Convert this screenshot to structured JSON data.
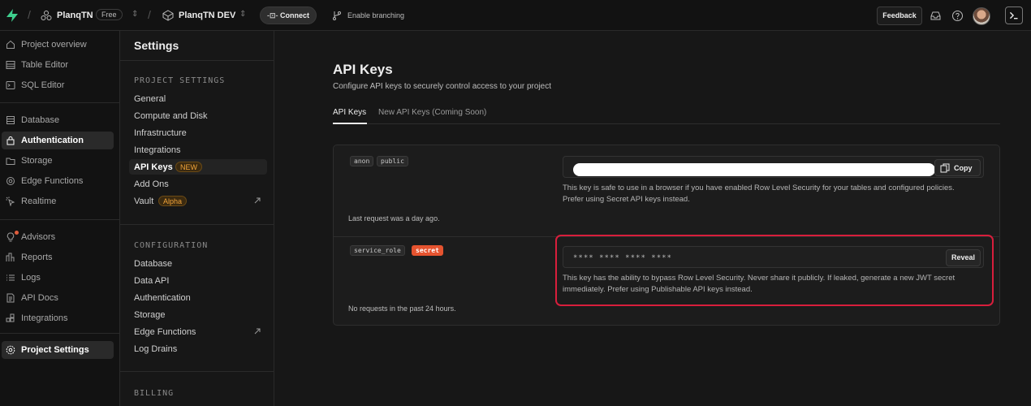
{
  "topbar": {
    "org_name": "PlanqTN",
    "org_plan": "Free",
    "project_name": "PlanqTN DEV",
    "connect_label": "Connect",
    "branching_label": "Enable branching",
    "feedback_label": "Feedback",
    "brand_color": "#3ecf8e"
  },
  "leftnav": {
    "items": [
      {
        "label": "Project overview",
        "icon": "home-icon"
      },
      {
        "label": "Table Editor",
        "icon": "table-icon"
      },
      {
        "label": "SQL Editor",
        "icon": "terminal-icon"
      },
      {
        "label": "Database",
        "icon": "database-icon"
      },
      {
        "label": "Authentication",
        "icon": "lock-icon"
      },
      {
        "label": "Storage",
        "icon": "folder-icon"
      },
      {
        "label": "Edge Functions",
        "icon": "gear-icon"
      },
      {
        "label": "Realtime",
        "icon": "cursor-icon"
      },
      {
        "label": "Advisors",
        "icon": "lightbulb-icon"
      },
      {
        "label": "Reports",
        "icon": "chart-icon"
      },
      {
        "label": "Logs",
        "icon": "list-icon"
      },
      {
        "label": "API Docs",
        "icon": "document-icon"
      },
      {
        "label": "Integrations",
        "icon": "puzzle-icon"
      },
      {
        "label": "Project Settings",
        "icon": "settings-icon"
      }
    ]
  },
  "settings": {
    "title": "Settings",
    "project_settings_label": "PROJECT SETTINGS",
    "project_items": [
      "General",
      "Compute and Disk",
      "Infrastructure",
      "Integrations",
      "API Keys",
      "Add Ons",
      "Vault"
    ],
    "new_badge": "NEW",
    "alpha_badge": "Alpha",
    "configuration_label": "CONFIGURATION",
    "config_items": [
      "Database",
      "Data API",
      "Authentication",
      "Storage",
      "Edge Functions",
      "Log Drains"
    ],
    "billing_label": "BILLING"
  },
  "main": {
    "title": "API Keys",
    "subtitle": "Configure API keys to securely control access to your project",
    "tabs": [
      "API Keys",
      "New API Keys (Coming Soon)"
    ],
    "keys": [
      {
        "tags": [
          "anon",
          "public"
        ],
        "last_request": "Last request was a day ago.",
        "action": "Copy",
        "description": "This key is safe to use in a browser if you have enabled Row Level Security for your tables and configured policies. Prefer using Secret API keys instead."
      },
      {
        "tags": [
          "service_role",
          "secret"
        ],
        "masked_value": "**** **** **** ****",
        "last_request": "No requests in the past 24 hours.",
        "action": "Reveal",
        "description": "This key has the ability to bypass Row Level Security. Never share it publicly. If leaked, generate a new JWT secret immediately. Prefer using Publishable API keys instead."
      }
    ]
  }
}
